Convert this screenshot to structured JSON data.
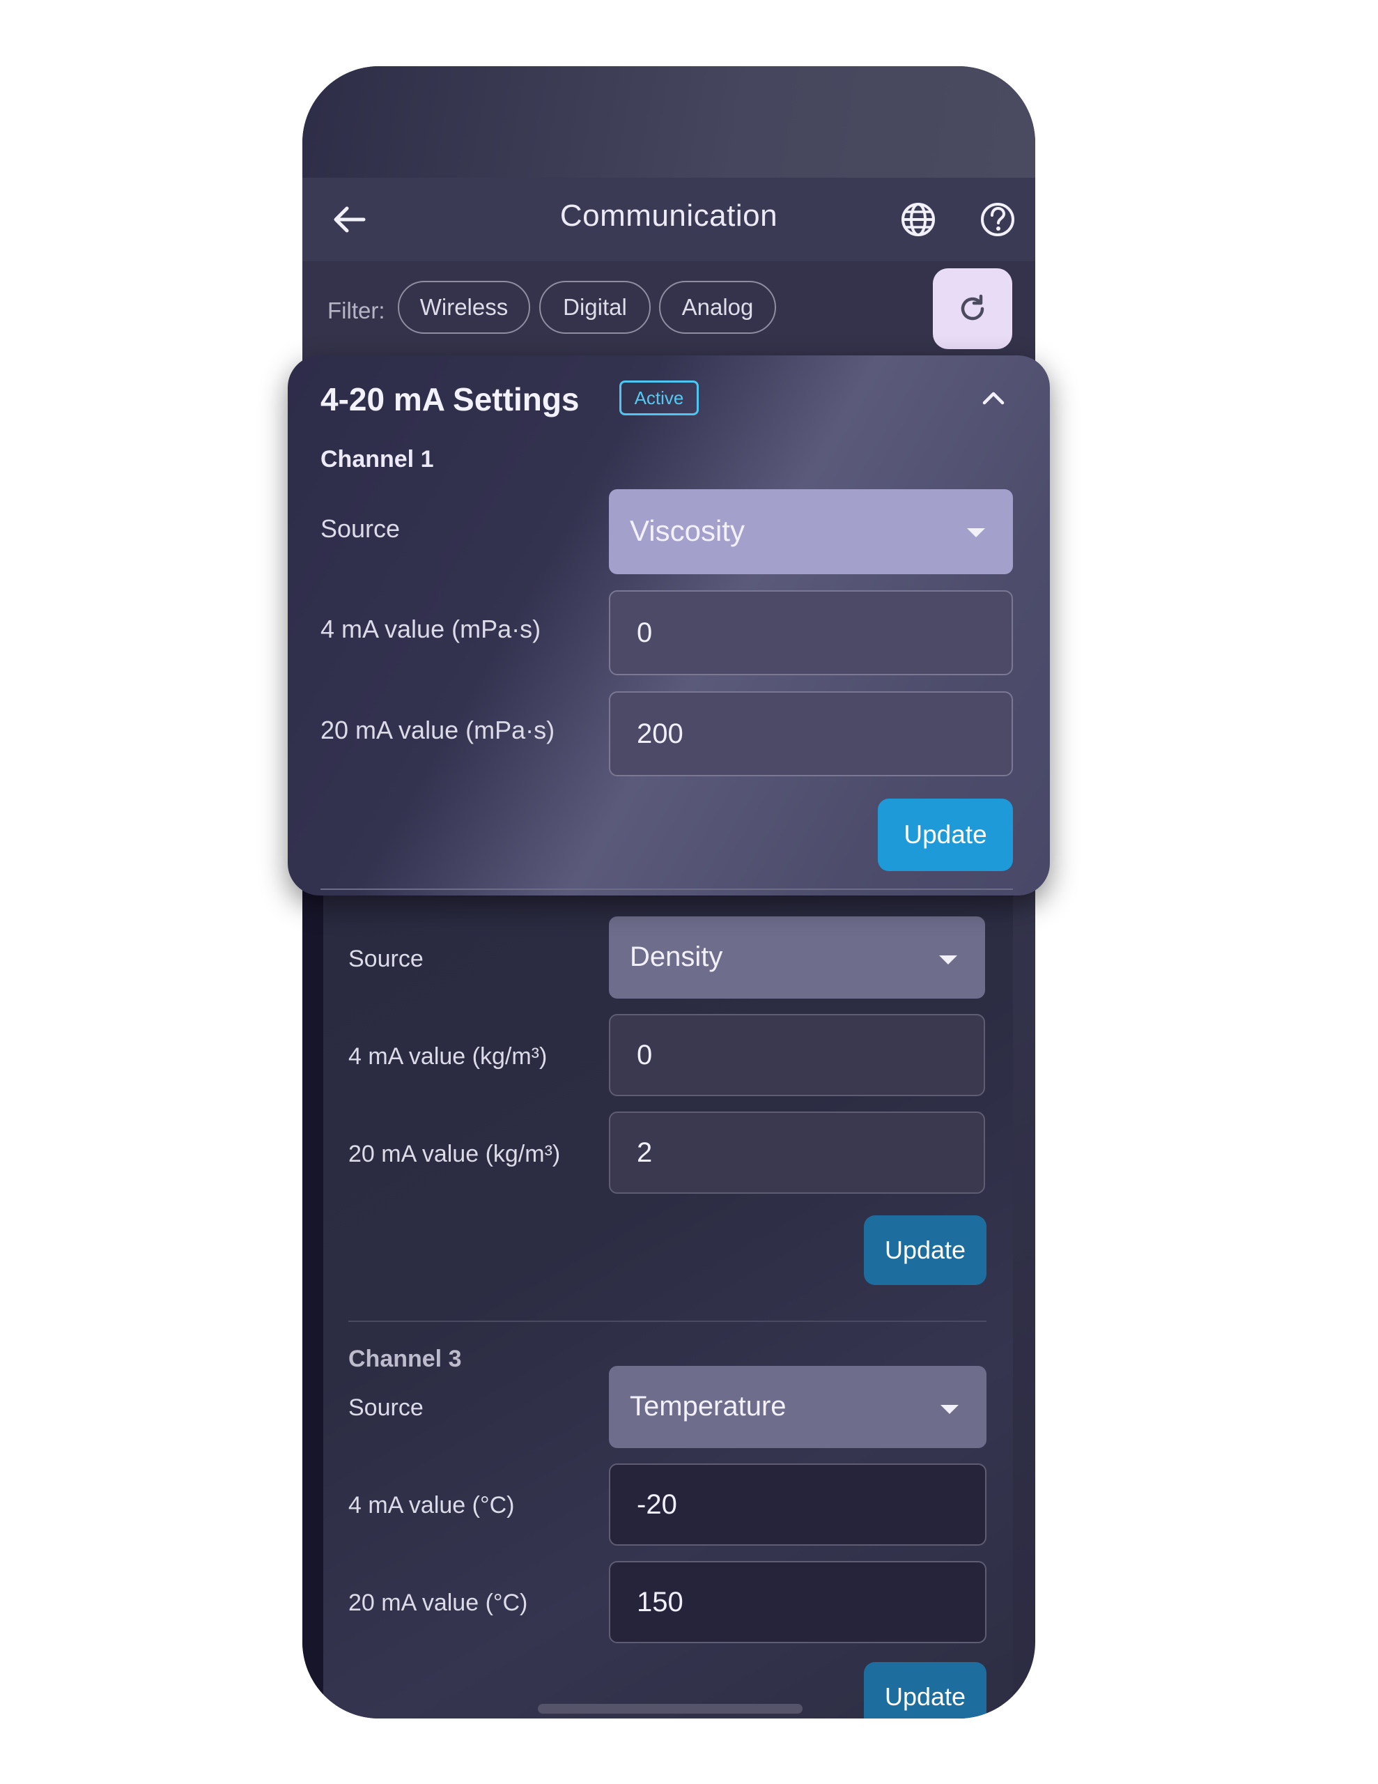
{
  "appbar": {
    "title": "Communication",
    "back_icon": "arrow-left-icon",
    "globe_icon": "globe-icon",
    "help_icon": "help-circle-icon"
  },
  "filter": {
    "label": "Filter:",
    "chips": [
      "Wireless",
      "Digital",
      "Analog"
    ],
    "refresh_icon": "refresh-icon"
  },
  "card": {
    "title": "4-20 mA Settings",
    "badge": "Active",
    "collapse_icon": "chevron-up-icon",
    "channel1": {
      "label": "Channel 1",
      "source_label": "Source",
      "source_value": "Viscosity",
      "low_label": "4 mA value (mPa·s)",
      "low_value": "0",
      "high_label": "20 mA value (mPa·s)",
      "high_value": "200",
      "update_label": "Update"
    }
  },
  "channel2": {
    "source_label": "Source",
    "source_value": "Density",
    "low_label": "4 mA value (kg/m³)",
    "low_value": "0",
    "high_label": "20 mA value (kg/m³)",
    "high_value": "2",
    "update_label": "Update"
  },
  "channel3": {
    "label": "Channel 3",
    "source_label": "Source",
    "source_value": "Temperature",
    "low_label": "4 mA value (°C)",
    "low_value": "-20",
    "high_label": "20 mA value (°C)",
    "high_value": "150",
    "update_label": "Update"
  },
  "colors": {
    "accent_blue": "#1f9ad8",
    "badge_cyan": "#4fc6f2",
    "refresh_bg": "#e9dcf7"
  }
}
